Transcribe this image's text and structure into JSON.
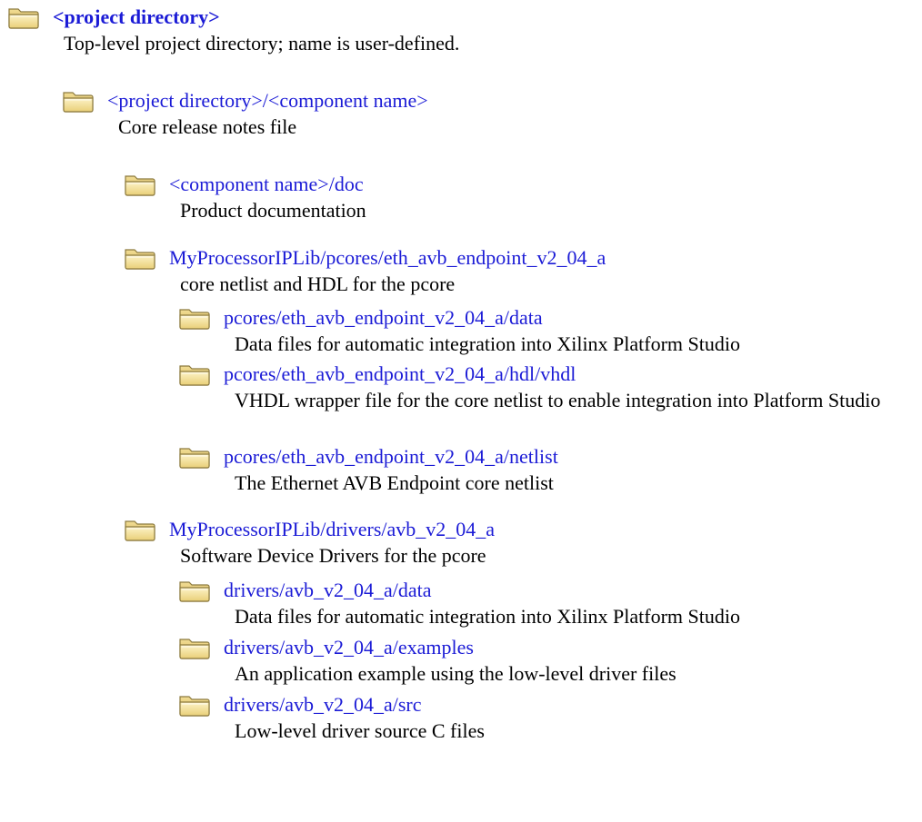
{
  "entries": [
    {
      "path": "<project directory>",
      "description": "Top-level project directory; name is user-defined."
    },
    {
      "path": "<project directory>/<component name>",
      "description": "Core release notes file"
    },
    {
      "path": "<component name>/doc",
      "description": "Product documentation"
    },
    {
      "path": "MyProcessorIPLib/pcores/eth_avb_endpoint_v2_04_a",
      "description": "core netlist and HDL for the pcore"
    },
    {
      "path": "pcores/eth_avb_endpoint_v2_04_a/data",
      "description": "Data files for automatic integration into Xilinx Platform Studio"
    },
    {
      "path": "pcores/eth_avb_endpoint_v2_04_a/hdl/vhdl",
      "description": "VHDL wrapper file for the core netlist to enable integration into Platform Studio"
    },
    {
      "path": "pcores/eth_avb_endpoint_v2_04_a/netlist",
      "description": "The Ethernet AVB Endpoint core netlist"
    },
    {
      "path": "MyProcessorIPLib/drivers/avb_v2_04_a",
      "description": "Software Device Drivers for the pcore"
    },
    {
      "path": "drivers/avb_v2_04_a/data",
      "description": "Data files for automatic integration into Xilinx Platform Studio"
    },
    {
      "path": "drivers/avb_v2_04_a/examples",
      "description": "An application example using the low-level driver files"
    },
    {
      "path": "drivers/avb_v2_04_a/src",
      "description": "Low-level driver source C files"
    }
  ]
}
